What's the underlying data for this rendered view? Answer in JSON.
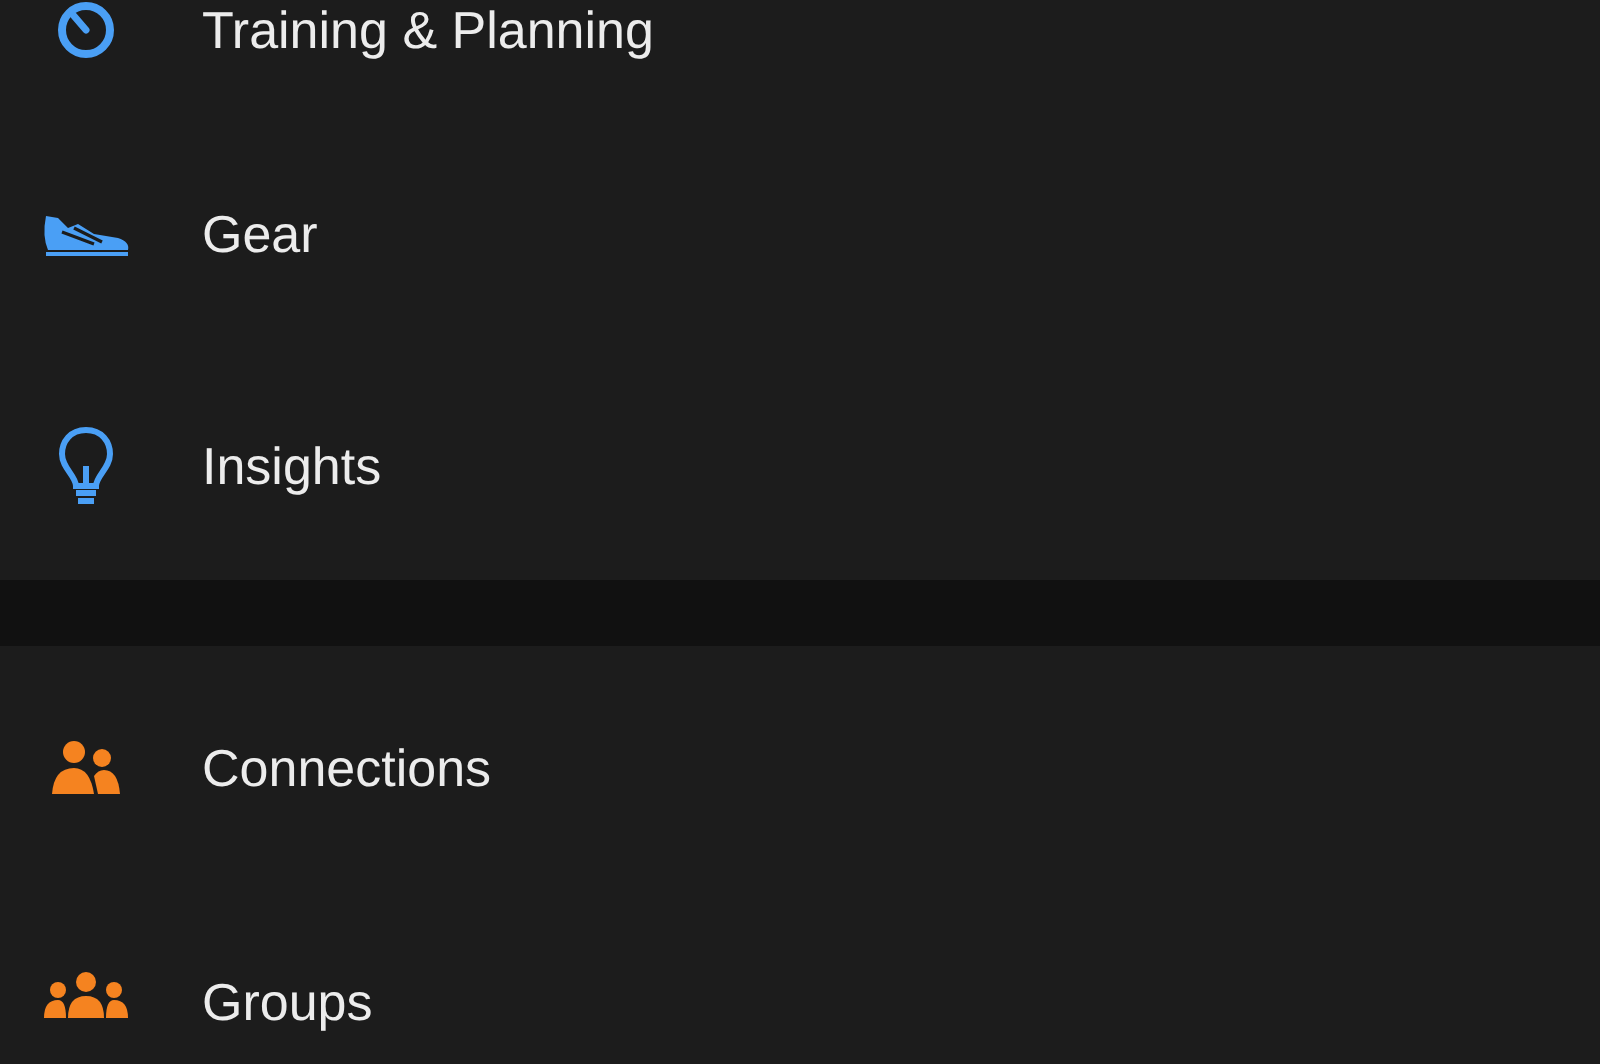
{
  "sections": [
    {
      "items": [
        {
          "label": "Training & Planning"
        },
        {
          "label": "Gear"
        },
        {
          "label": "Insights"
        }
      ]
    },
    {
      "items": [
        {
          "label": "Connections"
        },
        {
          "label": "Groups"
        }
      ]
    }
  ]
}
